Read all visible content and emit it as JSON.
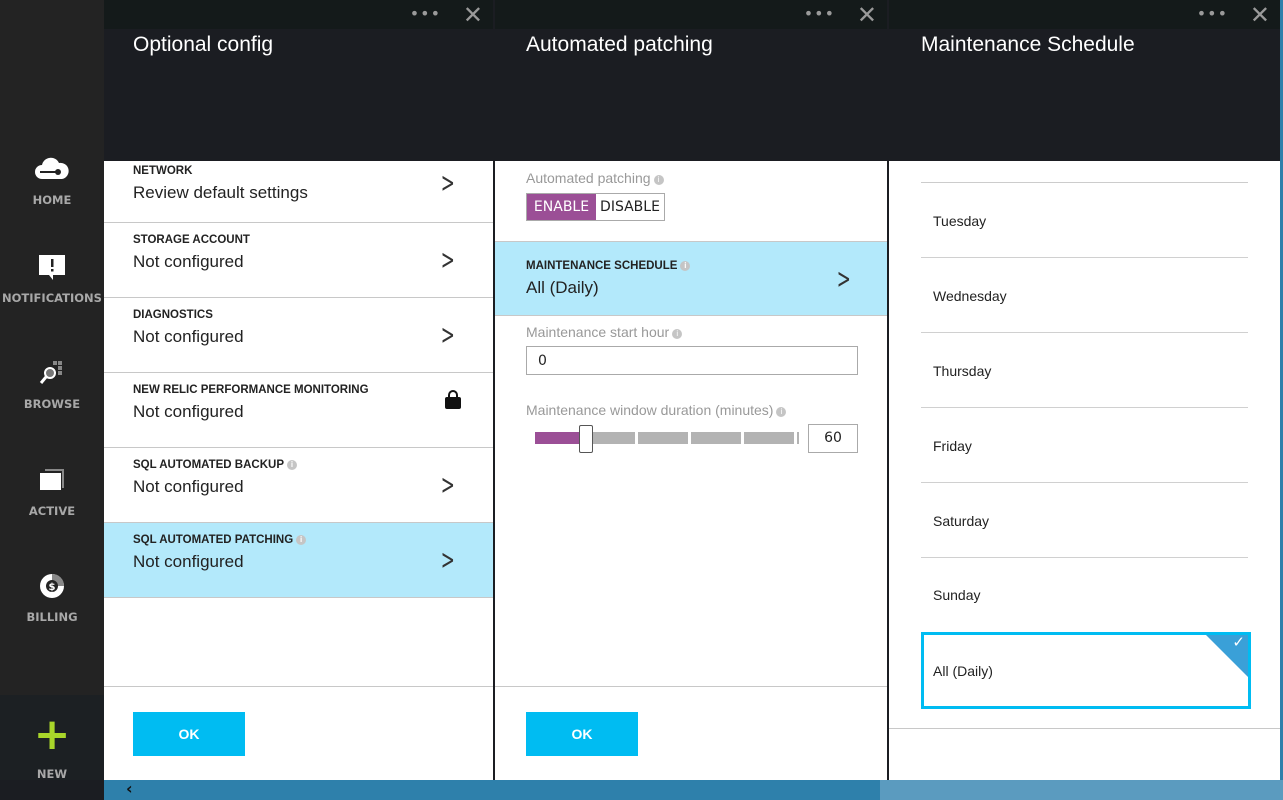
{
  "sidebar": {
    "items": [
      {
        "label": "HOME",
        "icon": "cloud-icon"
      },
      {
        "label": "NOTIFICATIONS",
        "icon": "notification-icon"
      },
      {
        "label": "BROWSE",
        "icon": "browse-icon"
      },
      {
        "label": "ACTIVE",
        "icon": "active-icon"
      },
      {
        "label": "BILLING",
        "icon": "billing-icon"
      }
    ],
    "new_label": "NEW"
  },
  "blade1": {
    "title": "Optional config",
    "ok": "OK",
    "rows": [
      {
        "label": "NETWORK",
        "value": "Review default settings"
      },
      {
        "label": "STORAGE ACCOUNT",
        "value": "Not configured"
      },
      {
        "label": "DIAGNOSTICS",
        "value": "Not configured"
      },
      {
        "label": "NEW RELIC PERFORMANCE MONITORING",
        "value": "Not configured"
      },
      {
        "label": "SQL AUTOMATED BACKUP",
        "value": "Not configured"
      },
      {
        "label": "SQL AUTOMATED PATCHING",
        "value": "Not configured"
      }
    ]
  },
  "blade2": {
    "title": "Automated patching",
    "patch_label": "Automated patching",
    "enable": "ENABLE",
    "disable": "DISABLE",
    "schedule_label": "MAINTENANCE SCHEDULE",
    "schedule_value": "All (Daily)",
    "start_label": "Maintenance start hour",
    "start_value": "0",
    "duration_label": "Maintenance window duration (minutes)",
    "duration_value": "60",
    "ok": "OK"
  },
  "blade3": {
    "title": "Maintenance Schedule",
    "days": [
      "Tuesday",
      "Wednesday",
      "Thursday",
      "Friday",
      "Saturday",
      "Sunday"
    ],
    "selected": "All (Daily)"
  },
  "colors": {
    "accent": "#00bcf2",
    "toggle": "#9b4f96",
    "selected": "#b3e9fb"
  }
}
